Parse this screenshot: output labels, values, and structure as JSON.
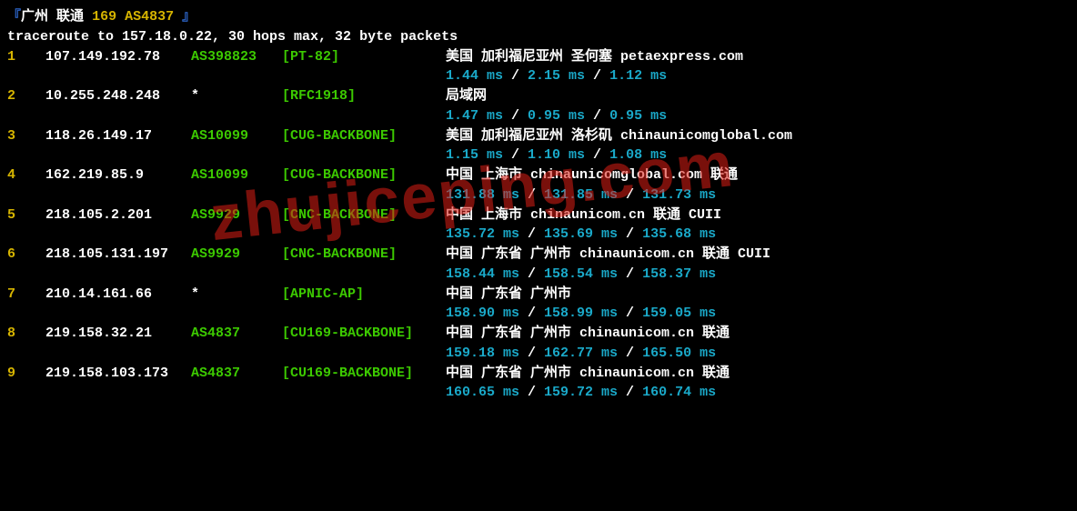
{
  "header": {
    "open_bracket": "『",
    "city": "广州",
    "carrier": "联通",
    "code": "169",
    "asn": "AS4837",
    "close_bracket": "』"
  },
  "subheader": "traceroute to 157.18.0.22, 30 hops max, 32 byte packets",
  "watermark": "zhujiceping.com",
  "hops": [
    {
      "num": "1",
      "ip": "107.149.192.78",
      "asn": "AS398823",
      "asn_is_star": false,
      "bracket": "[PT-82]",
      "loc": "美国 加利福尼亚州 圣何塞  petaexpress.com",
      "t1": "1.44 ms",
      "t2": "2.15 ms",
      "t3": "1.12 ms"
    },
    {
      "num": "2",
      "ip": "10.255.248.248",
      "asn": "*",
      "asn_is_star": true,
      "bracket": "[RFC1918]",
      "loc": "局域网",
      "t1": "1.47 ms",
      "t2": "0.95 ms",
      "t3": "0.95 ms"
    },
    {
      "num": "3",
      "ip": "118.26.149.17",
      "asn": "AS10099",
      "asn_is_star": false,
      "bracket": "[CUG-BACKBONE]",
      "loc": "美国 加利福尼亚州 洛杉矶  chinaunicomglobal.com",
      "t1": "1.15 ms",
      "t2": "1.10 ms",
      "t3": "1.08 ms"
    },
    {
      "num": "4",
      "ip": "162.219.85.9",
      "asn": "AS10099",
      "asn_is_star": false,
      "bracket": "[CUG-BACKBONE]",
      "loc": "中国 上海市   chinaunicomglobal.com  联通",
      "t1": "131.88 ms",
      "t2": "131.85 ms",
      "t3": "131.73 ms"
    },
    {
      "num": "5",
      "ip": "218.105.2.201",
      "asn": "AS9929",
      "asn_is_star": false,
      "bracket": "[CNC-BACKBONE]",
      "loc": "中国 上海市  chinaunicom.cn  联通 CUII",
      "t1": "135.72 ms",
      "t2": "135.69 ms",
      "t3": "135.68 ms"
    },
    {
      "num": "6",
      "ip": "218.105.131.197",
      "asn": "AS9929",
      "asn_is_star": false,
      "bracket": "[CNC-BACKBONE]",
      "loc": "中国 广东省 广州市  chinaunicom.cn  联通 CUII",
      "t1": "158.44 ms",
      "t2": "158.54 ms",
      "t3": "158.37 ms"
    },
    {
      "num": "7",
      "ip": "210.14.161.66",
      "asn": "*",
      "asn_is_star": true,
      "bracket": "[APNIC-AP]",
      "loc": "中国 广东省 广州市",
      "t1": "158.90 ms",
      "t2": "158.99 ms",
      "t3": "159.05 ms"
    },
    {
      "num": "8",
      "ip": "219.158.32.21",
      "asn": "AS4837",
      "asn_is_star": false,
      "bracket": "[CU169-BACKBONE]",
      "loc": "中国 广东省 广州市  chinaunicom.cn  联通",
      "t1": "159.18 ms",
      "t2": "162.77 ms",
      "t3": "165.50 ms"
    },
    {
      "num": "9",
      "ip": "219.158.103.173",
      "asn": "AS4837",
      "asn_is_star": false,
      "bracket": "[CU169-BACKBONE]",
      "loc": "中国 广东省 广州市  chinaunicom.cn  联通",
      "t1": "160.65 ms",
      "t2": "159.72 ms",
      "t3": "160.74 ms"
    }
  ]
}
